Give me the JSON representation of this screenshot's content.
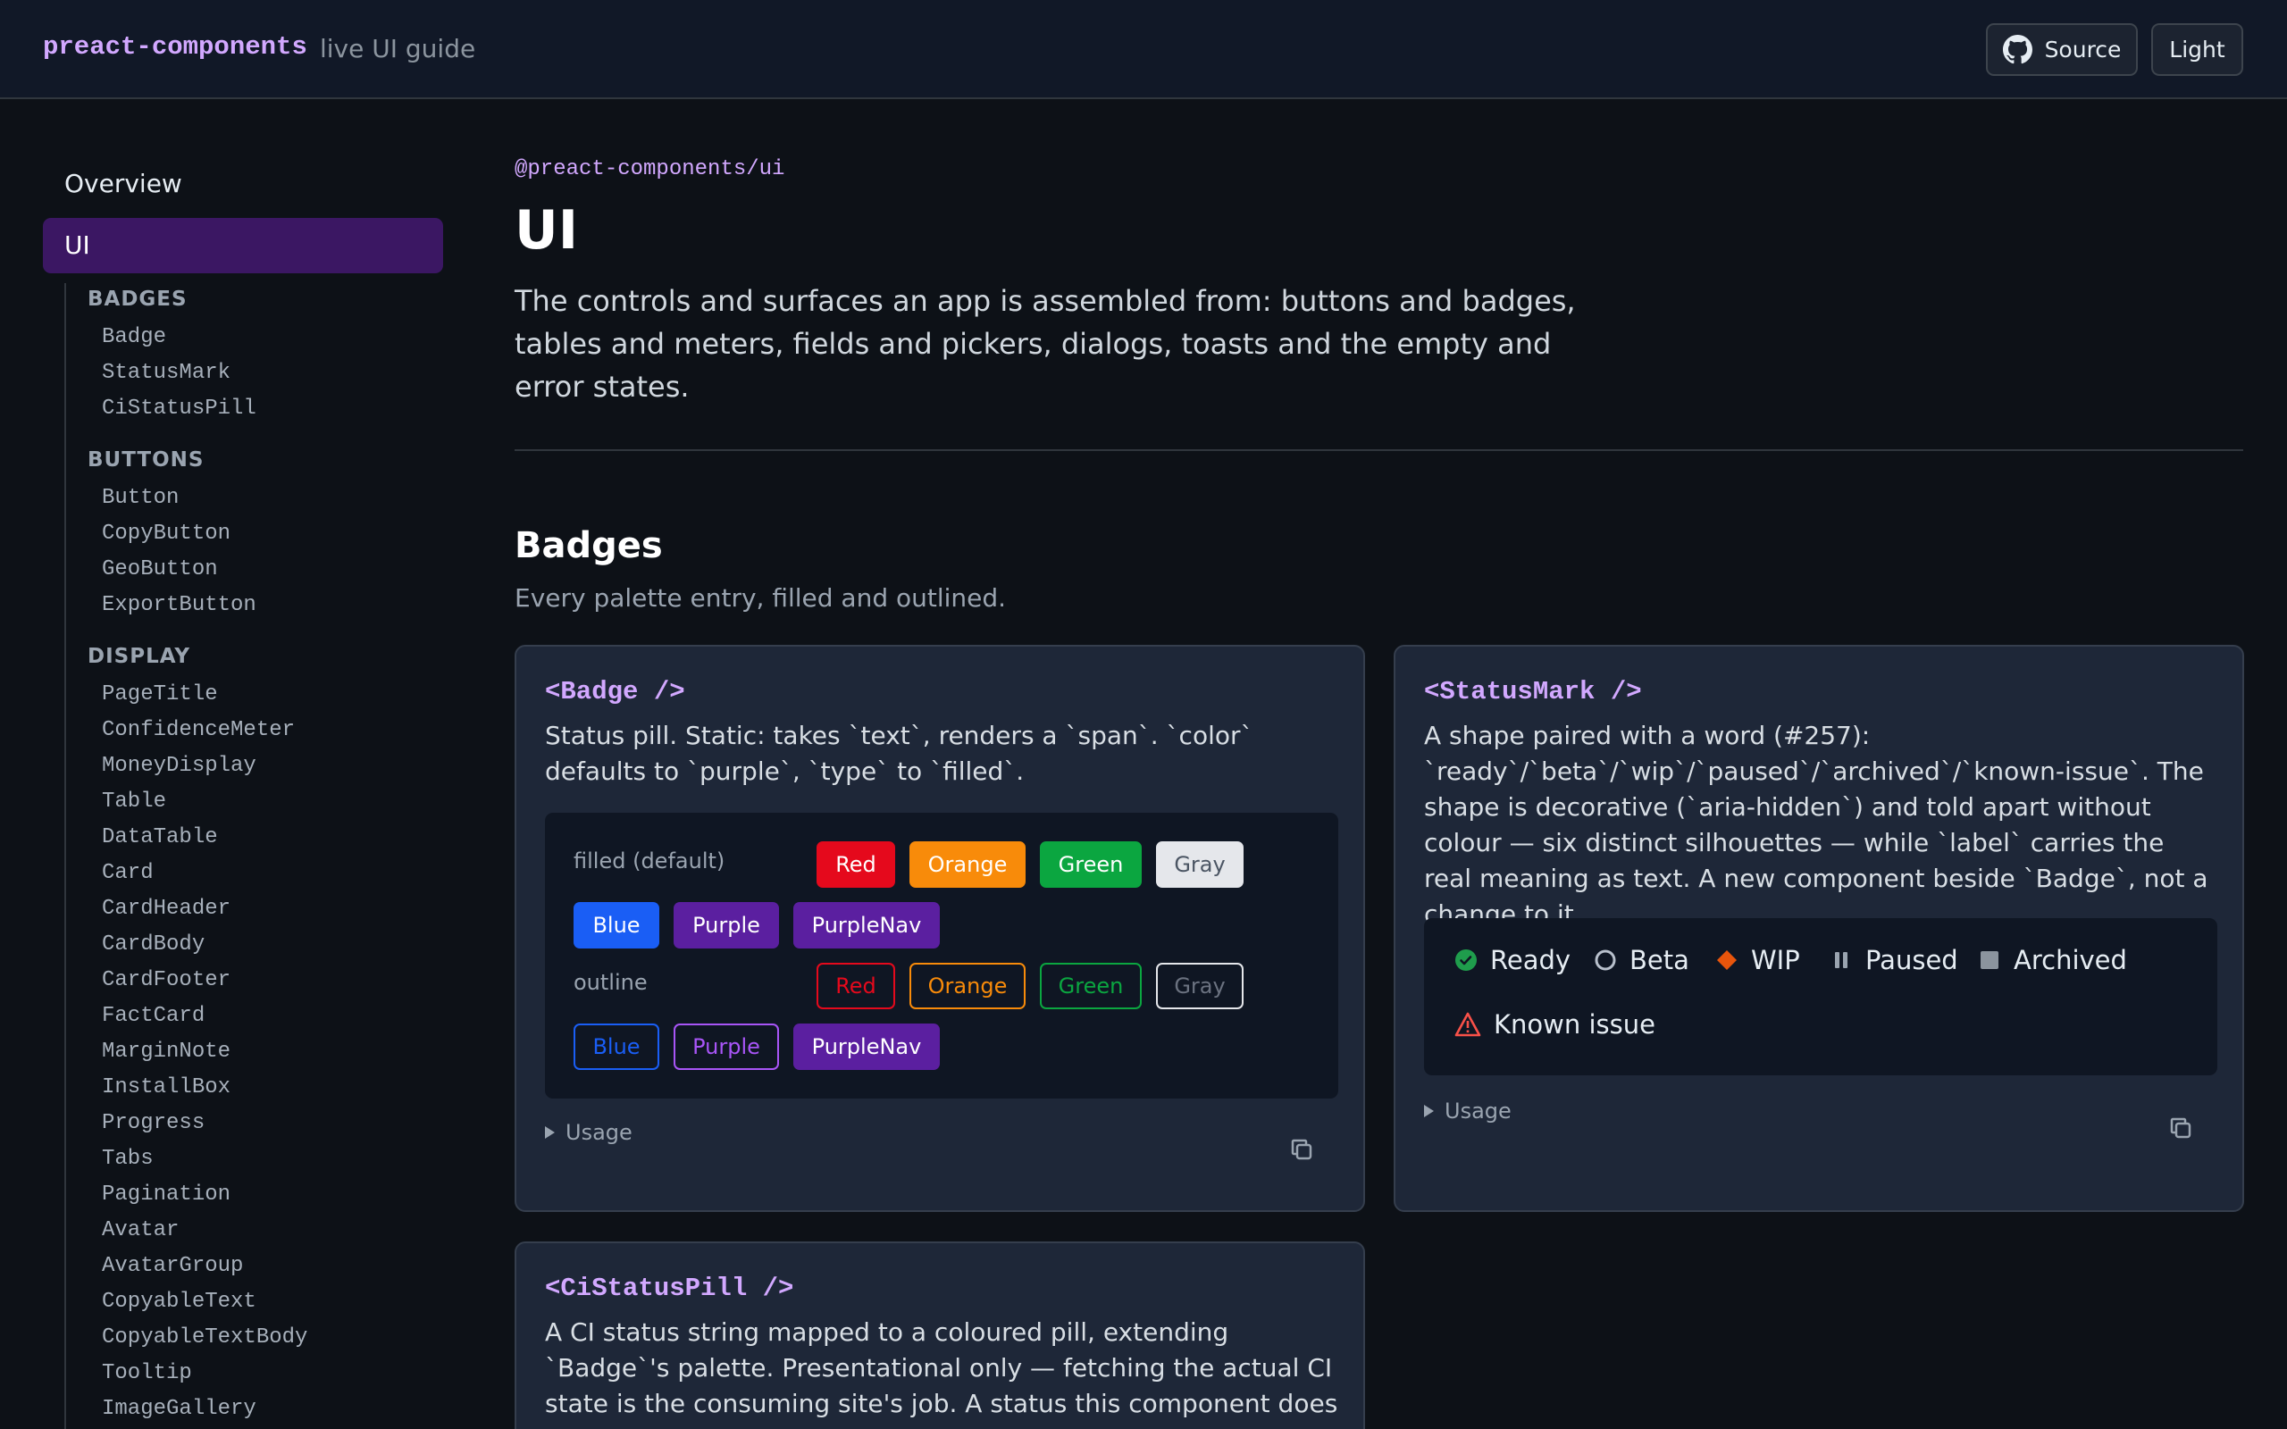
{
  "header": {
    "brand": "preact-components",
    "tagline": "live UI guide",
    "source_label": "Source",
    "theme_label": "Light"
  },
  "sidebar": {
    "overview": "Overview",
    "active": "UI",
    "groups": [
      {
        "title": "BADGES",
        "items": [
          "Badge",
          "StatusMark",
          "CiStatusPill"
        ]
      },
      {
        "title": "BUTTONS",
        "items": [
          "Button",
          "CopyButton",
          "GeoButton",
          "ExportButton"
        ]
      },
      {
        "title": "DISPLAY",
        "items": [
          "PageTitle",
          "ConfidenceMeter",
          "MoneyDisplay",
          "Table",
          "DataTable",
          "Card",
          "CardHeader",
          "CardBody",
          "CardFooter",
          "FactCard",
          "MarginNote",
          "InstallBox",
          "Progress",
          "Tabs",
          "Pagination",
          "Avatar",
          "AvatarGroup",
          "CopyableText",
          "CopyableTextBody",
          "Tooltip",
          "ImageGallery"
        ]
      }
    ]
  },
  "main": {
    "package": "@preact-components/ui",
    "title": "UI",
    "description": "The controls and surfaces an app is assembled from: buttons and badges, tables and meters, fields and pickers, dialogs, toasts and the empty and error states.",
    "section": {
      "title": "Badges",
      "subtitle": "Every palette entry, filled and outlined."
    }
  },
  "cards": {
    "badge": {
      "title": "<Badge />",
      "description": "Status pill. Static: takes `text`, renders a `span`. `color` defaults to `purple`, `type` to `filled`.",
      "filled_label": "filled (default)",
      "outline_label": "outline",
      "filled": [
        "Red",
        "Orange",
        "Green",
        "Gray",
        "Blue",
        "Purple",
        "PurpleNav"
      ],
      "outline": [
        "Red",
        "Orange",
        "Green",
        "Gray",
        "Blue",
        "Purple",
        "PurpleNav"
      ],
      "usage": "Usage"
    },
    "status": {
      "title": "<StatusMark />",
      "description": "A shape paired with a word (#257): `ready`/`beta`/`wip`/`paused`/`archived`/`known-issue`. The shape is decorative (`aria-hidden`) and told apart without colour — six distinct silhouettes — while `label` carries the real meaning as text. A new component beside `Badge`, not a change to it.",
      "marks": [
        "Ready",
        "Beta",
        "WIP",
        "Paused",
        "Archived",
        "Known issue"
      ],
      "usage": "Usage"
    },
    "ci": {
      "title": "<CiStatusPill />",
      "description": "A CI status string mapped to a coloured pill, extending `Badge`'s palette. Presentational only — fetching the actual CI state is the consuming site's job. A status this component does not recognise"
    }
  },
  "colors": {
    "red": "#e5091c",
    "orange": "#f88b0a",
    "green": "#0ba640",
    "gray": "#e5e7eb",
    "blue": "#1a5ef5",
    "purple": "#5b1fa0",
    "purple_outline": "#a855f7",
    "accent": "#d2a8ff"
  }
}
